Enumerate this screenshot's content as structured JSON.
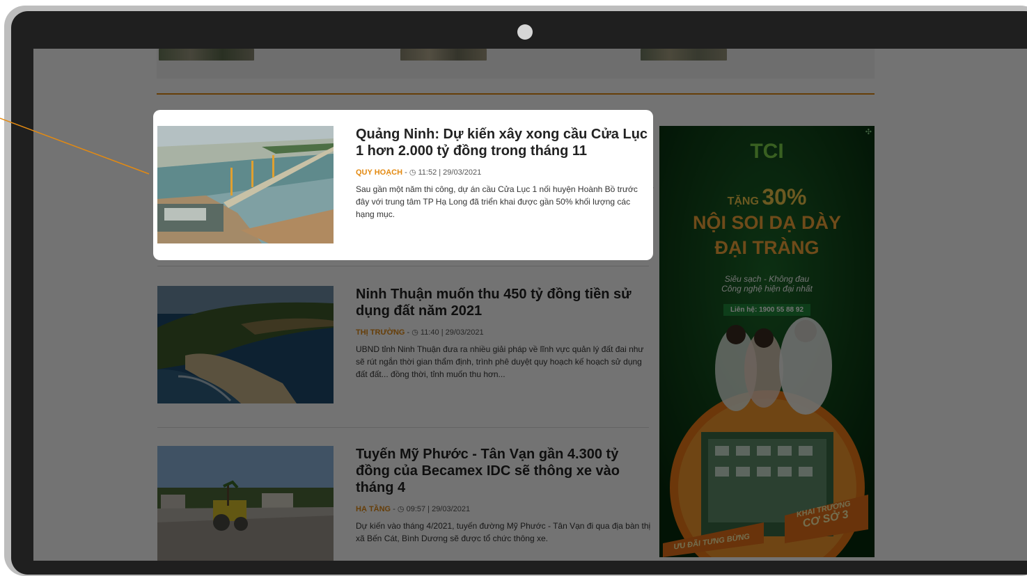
{
  "articles": [
    {
      "title": "Quảng Ninh: Dự kiến xây xong cầu Cửa Lục 1 hơn 2.000 tỷ đồng trong tháng 11",
      "category": "QUY HOẠCH",
      "time": "11:52 | 29/03/2021",
      "summary": "Sau gần một năm thi công, dự án cầu Cửa Lục 1 nối huyện Hoành Bồ trước đây với trung tâm TP Hạ Long đã triển khai được gần 50% khối lượng các hạng mục."
    },
    {
      "title": "Ninh Thuận muốn thu 450 tỷ đồng tiền sử dụng đất năm 2021",
      "category": "THỊ TRƯỜNG",
      "time": "11:40 | 29/03/2021",
      "summary": "UBND tỉnh Ninh Thuận đưa ra nhiều giải pháp về lĩnh vực quản lý đất đai như sẽ rút ngắn thời gian thẩm định, trình phê duyệt quy hoạch kế hoạch sử dụng đất đất... đồng thời, tỉnh muốn thu hơn..."
    },
    {
      "title": "Tuyến Mỹ Phước - Tân Vạn gần 4.300 tỷ đồng của Becamex IDC sẽ thông xe vào tháng 4",
      "category": "HẠ TẦNG",
      "time": "09:57 | 29/03/2021",
      "summary": "Dự kiến vào tháng 4/2021, tuyến đường Mỹ Phước - Tân Vạn đi qua địa bàn thị xã Bến Cát, Bình Dương sẽ được tổ chức thông xe."
    }
  ],
  "ad": {
    "logo": "TCI",
    "offer_prefix": "TẶNG",
    "offer_value": "30%",
    "headline_1": "NỘI SOI DẠ DÀY",
    "headline_2": "ĐẠI TRÀNG",
    "tagline_1": "Siêu sạch - Không đau",
    "tagline_2": "Công nghệ hiện đại nhất",
    "contact": "Liên hệ: 1900 55 88 92",
    "banner_left": "ƯU ĐÃI TƯNG BỪNG",
    "banner_right_1": "KHAI TRƯƠNG",
    "banner_right_2": "CƠ SỞ 3"
  },
  "colors": {
    "accent": "#e38a12",
    "ad_green": "#0b3b14",
    "ad_orange": "#f07a18"
  }
}
